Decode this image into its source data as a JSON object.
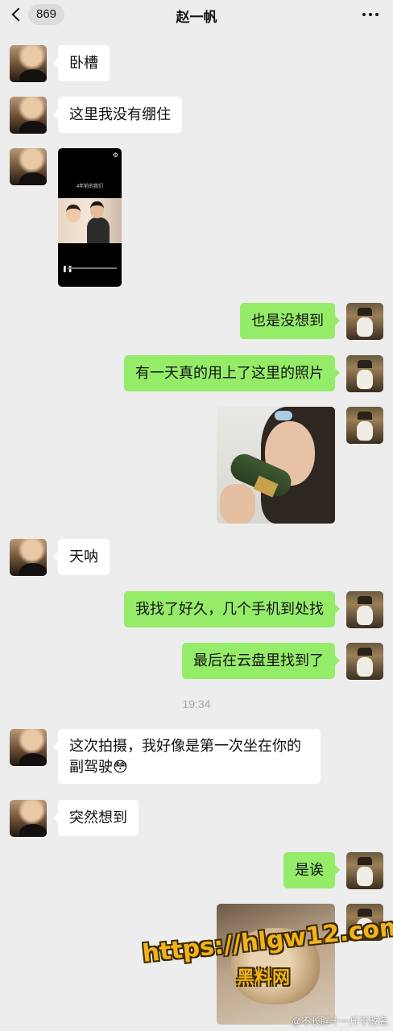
{
  "header": {
    "unread_count": "869",
    "title": "赵一帆"
  },
  "messages": [
    {
      "side": "left",
      "text": "卧槽"
    },
    {
      "side": "left",
      "text": "这里我没有绷住"
    },
    {
      "side": "left",
      "type": "video",
      "caption": "4年前的我们"
    },
    {
      "side": "right",
      "text": "也是没想到"
    },
    {
      "side": "right",
      "text": "有一天真的用上了这里的照片"
    },
    {
      "side": "right",
      "type": "image"
    },
    {
      "side": "left",
      "text": "天呐"
    },
    {
      "side": "right",
      "text": "我找了好久，几个手机到处找"
    },
    {
      "side": "right",
      "text": "最后在云盘里找到了"
    },
    {
      "side": "left",
      "text": "这次拍摄，我好像是第一次坐在你的副驾驶😳"
    },
    {
      "side": "left",
      "text": "突然想到"
    },
    {
      "side": "right",
      "text": "是诶"
    },
    {
      "side": "right",
      "type": "image"
    }
  ],
  "timestamp": "19:34",
  "watermark": {
    "url": "https://hlgw12.com",
    "name": "黑料网",
    "signature": "@不长胖十一斤不改名"
  },
  "colors": {
    "background": "#ededed",
    "bubble_self": "#95ec69",
    "bubble_other": "#ffffff",
    "watermark": "#f2b21a"
  }
}
